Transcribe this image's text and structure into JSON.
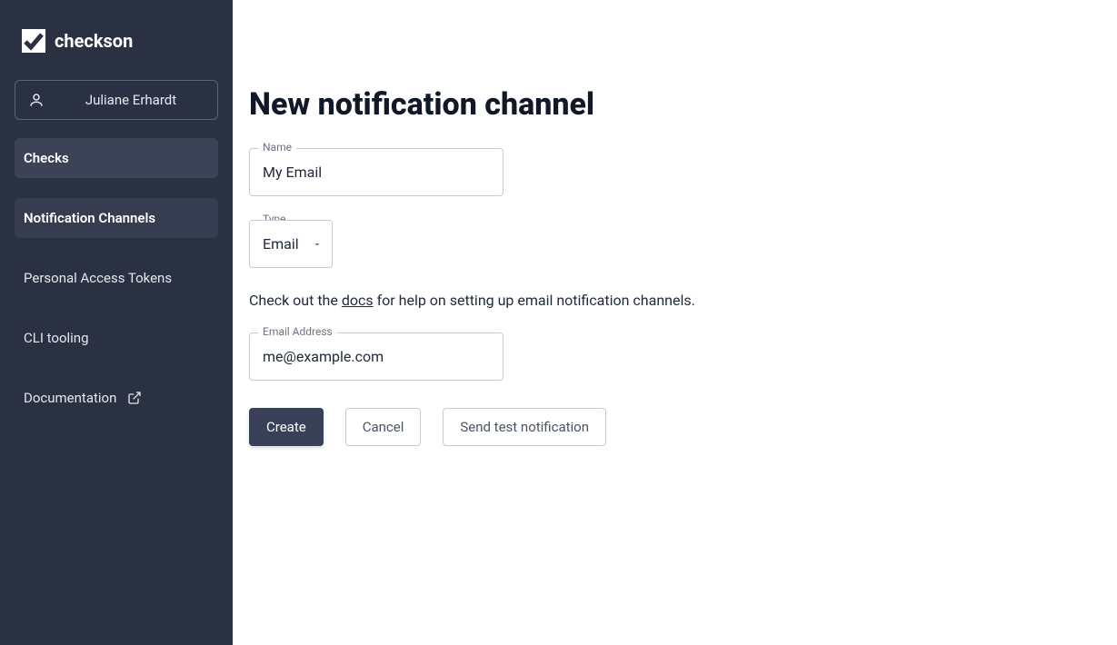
{
  "brand": {
    "name": "checkson"
  },
  "user": {
    "name": "Juliane Erhardt"
  },
  "sidebar": {
    "items": [
      {
        "label": "Checks"
      },
      {
        "label": "Notification Channels"
      },
      {
        "label": "Personal Access Tokens"
      },
      {
        "label": "CLI tooling"
      },
      {
        "label": "Documentation"
      }
    ]
  },
  "main": {
    "title": "New notification channel",
    "name_label": "Name",
    "name_value": "My Email",
    "type_label": "Type",
    "type_value": "Email",
    "help_pre": "Check out the ",
    "help_link": "docs",
    "help_post": " for help on setting up email notification channels.",
    "email_label": "Email Address",
    "email_value": "me@example.com",
    "buttons": {
      "create": "Create",
      "cancel": "Cancel",
      "send_test": "Send test notification"
    }
  }
}
